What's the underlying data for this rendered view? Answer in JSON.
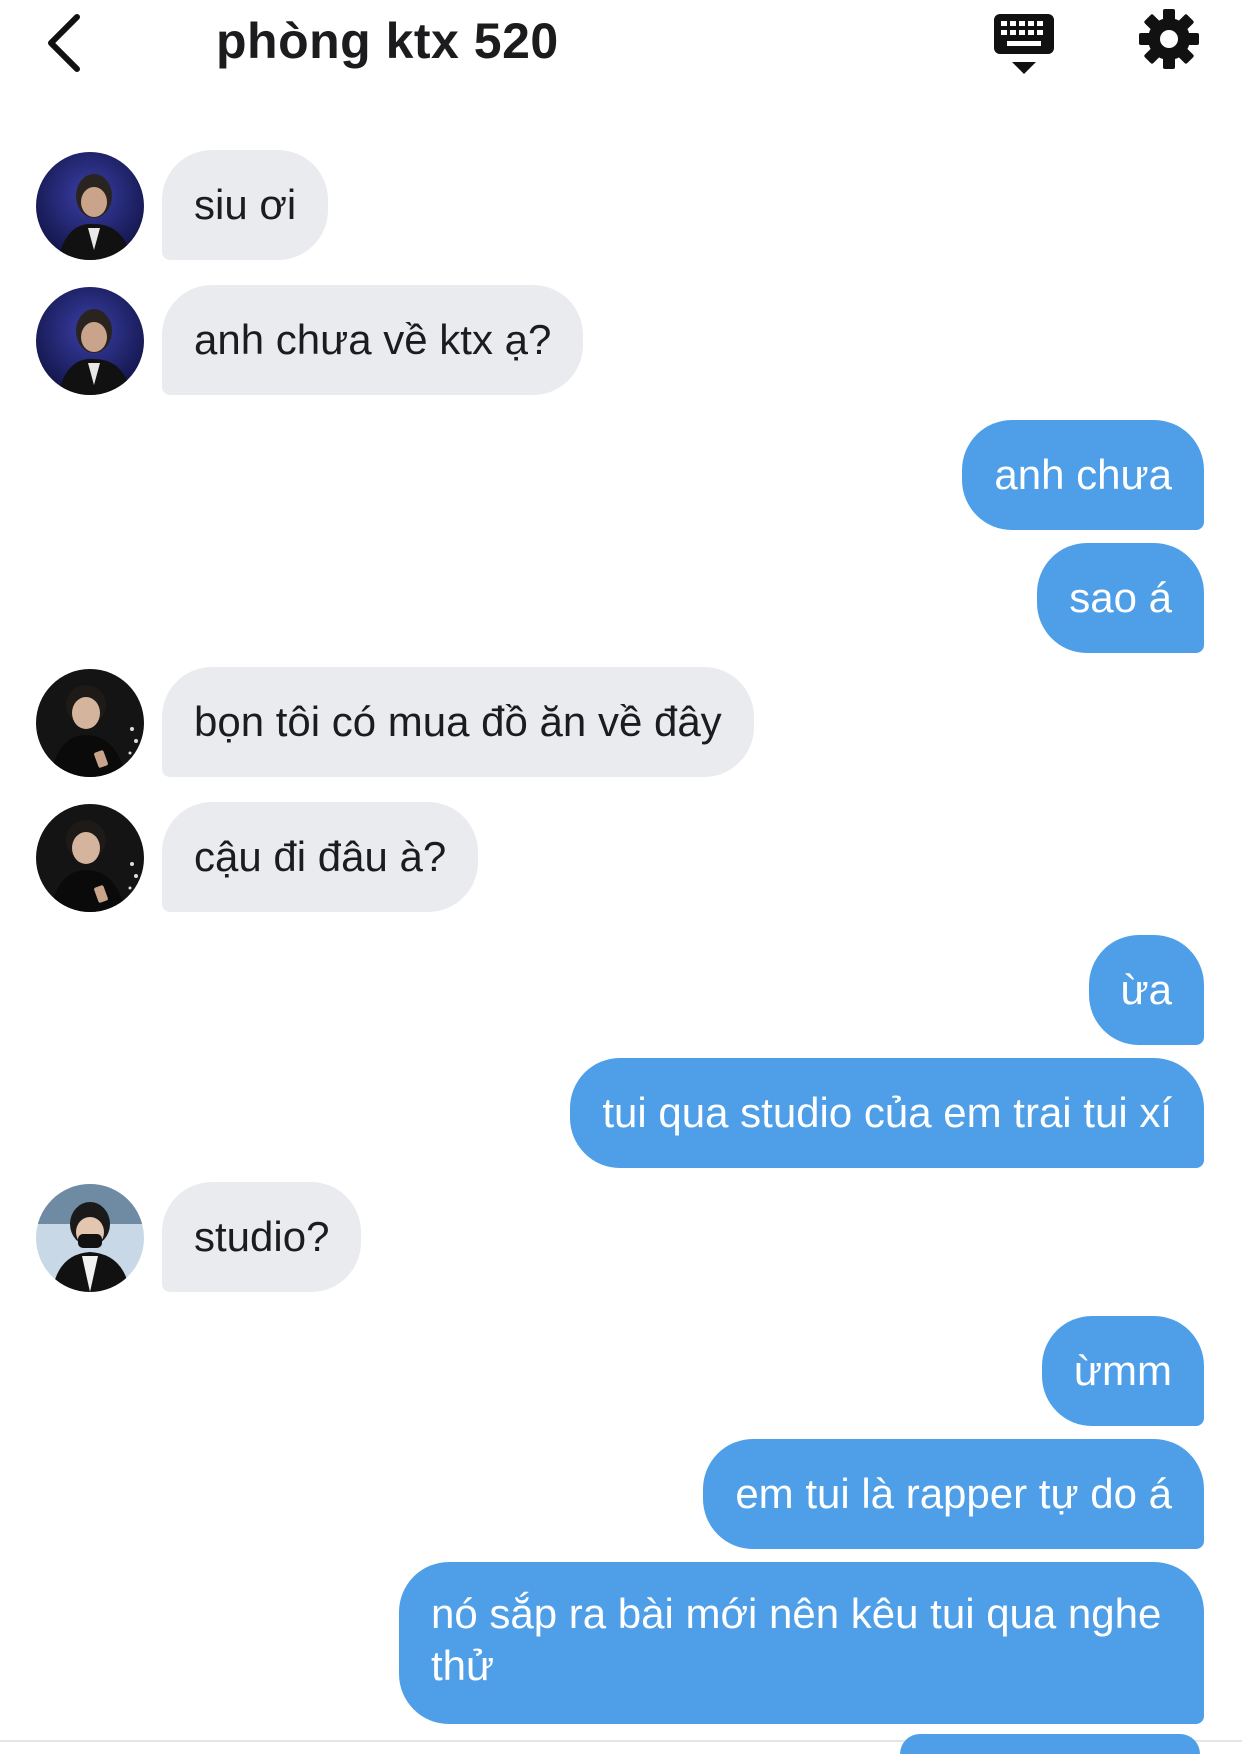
{
  "header": {
    "title": "phòng ktx 520",
    "back_icon": "chevron-left-icon",
    "keyboard_icon": "keyboard-dismiss-icon",
    "settings_icon": "gear-icon"
  },
  "colors": {
    "incoming_bubble": "#e9ebee",
    "outgoing_bubble": "#4f9fe8",
    "outgoing_text": "#ffffff"
  },
  "messages": [
    {
      "side": "in",
      "text": "siu ơi"
    },
    {
      "side": "in",
      "text": "anh chưa về ktx ạ?"
    },
    {
      "side": "out",
      "text": "anh chưa"
    },
    {
      "side": "out",
      "text": "sao á"
    },
    {
      "side": "in",
      "text": "bọn tôi có mua đồ ăn về đây"
    },
    {
      "side": "in",
      "text": "cậu đi đâu à?"
    },
    {
      "side": "out",
      "text": "ừa"
    },
    {
      "side": "out",
      "text": "tui qua studio của em trai tui xí"
    },
    {
      "side": "in",
      "text": "studio?"
    },
    {
      "side": "out",
      "text": "ừmm"
    },
    {
      "side": "out",
      "text": "em tui là rapper tự do á"
    },
    {
      "side": "out",
      "text": "nó sắp ra bài mới nên kêu tui qua nghe thử"
    }
  ]
}
